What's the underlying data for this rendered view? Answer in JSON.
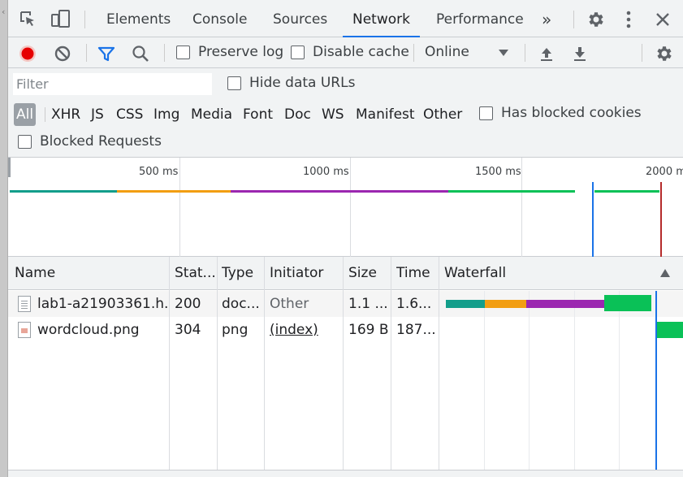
{
  "tabs": [
    {
      "label": "Elements"
    },
    {
      "label": "Console"
    },
    {
      "label": "Sources"
    },
    {
      "label": "Network",
      "active": true
    },
    {
      "label": "Performance"
    }
  ],
  "tabs_overflow": "»",
  "toolbar": {
    "preserve_log": "Preserve log",
    "disable_cache": "Disable cache",
    "throttle": "Online"
  },
  "filter": {
    "placeholder": "Filter",
    "hide_data_urls": "Hide data URLs",
    "types": [
      "All",
      "XHR",
      "JS",
      "CSS",
      "Img",
      "Media",
      "Font",
      "Doc",
      "WS",
      "Manifest",
      "Other"
    ],
    "active_type": "All",
    "has_blocked_cookies": "Has blocked cookies",
    "blocked_requests": "Blocked Requests"
  },
  "overview": {
    "ticks": [
      "500 ms",
      "1000 ms",
      "1500 ms",
      "2000 m"
    ]
  },
  "table": {
    "headers": [
      "Name",
      "Stat...",
      "Type",
      "Initiator",
      "Size",
      "Time",
      "Waterfall"
    ],
    "rows": [
      {
        "name": "lab1-a21903361.h...",
        "status": "200",
        "type": "doc...",
        "initiator": "Other",
        "size": "1.1 ...",
        "time": "1.6..."
      },
      {
        "name": "wordcloud.png",
        "status": "304",
        "type": "png",
        "initiator": "(index)",
        "size": "169 B",
        "time": "187..."
      }
    ]
  },
  "colors": {
    "accent": "#1a73e8",
    "record": "#e60000",
    "wf_teal": "#139e8b",
    "wf_orange": "#f29e12",
    "wf_purple": "#9b27b0",
    "wf_green": "#0ac157",
    "dom_line": "#1a73e8",
    "load_line": "#b52b2b"
  }
}
